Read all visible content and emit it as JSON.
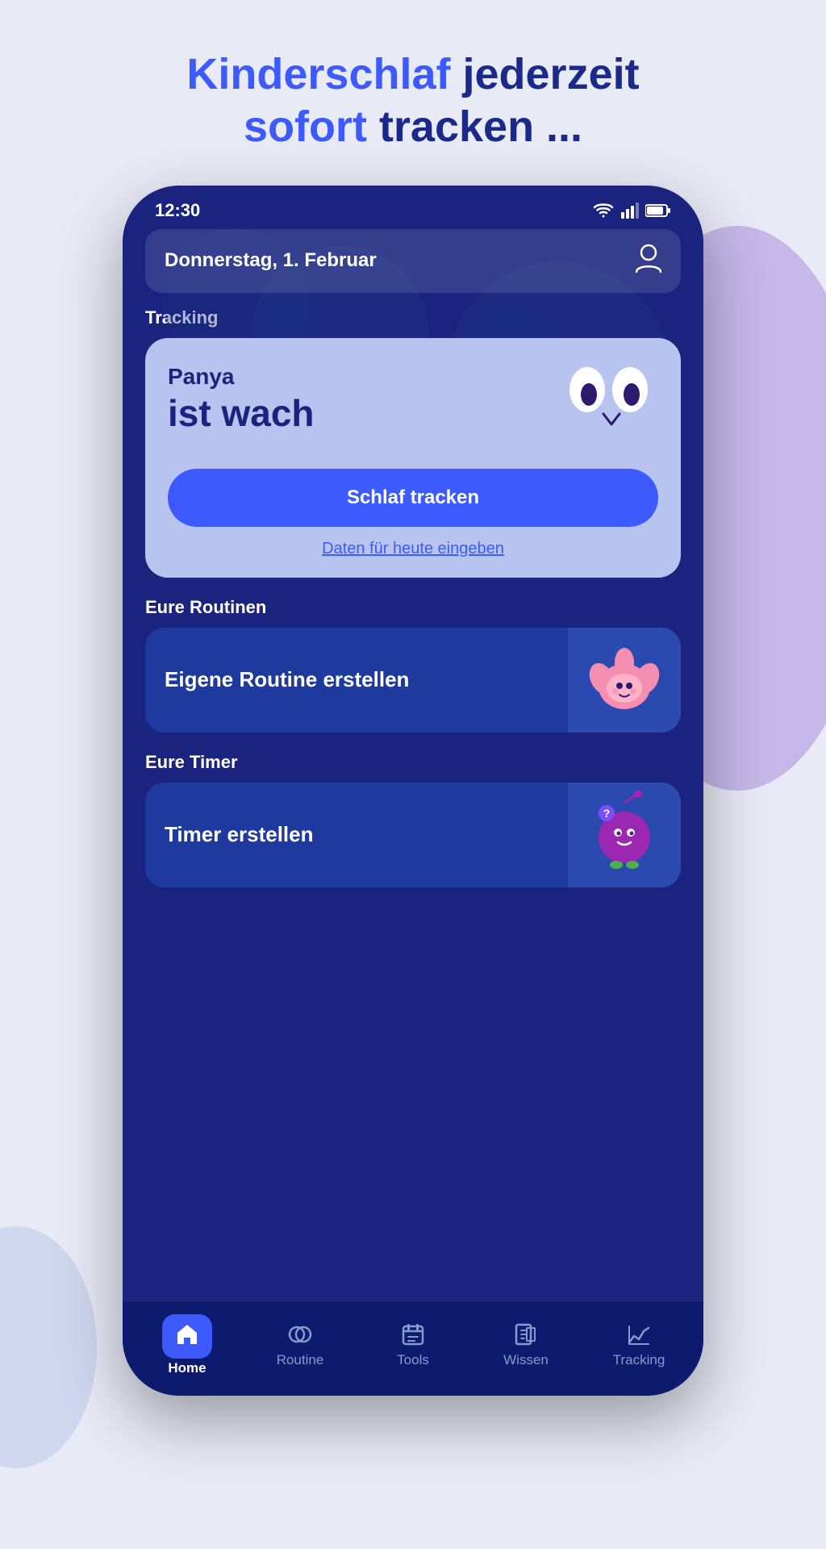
{
  "page": {
    "title_part1": "Kinderschlaf",
    "title_part2": "jederzeit",
    "title_part3": "sofort",
    "title_part4": "tracken ..."
  },
  "status_bar": {
    "time": "12:30"
  },
  "header": {
    "date": "Donnerstag, 1. Februar"
  },
  "tracking_section": {
    "label": "Tracking",
    "child_name": "Panya",
    "child_state": "ist wach",
    "sleep_button": "Schlaf tracken",
    "data_link": "Daten für heute eingeben"
  },
  "routines_section": {
    "label": "Eure Routinen",
    "card_text": "Eigene Routine erstellen"
  },
  "timer_section": {
    "label": "Eure Timer",
    "card_text": "Timer erstellen"
  },
  "bottom_nav": {
    "items": [
      {
        "id": "home",
        "label": "Home",
        "active": true
      },
      {
        "id": "routine",
        "label": "Routine",
        "active": false
      },
      {
        "id": "tools",
        "label": "Tools",
        "active": false
      },
      {
        "id": "wissen",
        "label": "Wissen",
        "active": false
      },
      {
        "id": "tracking",
        "label": "Tracking",
        "active": false
      }
    ]
  }
}
